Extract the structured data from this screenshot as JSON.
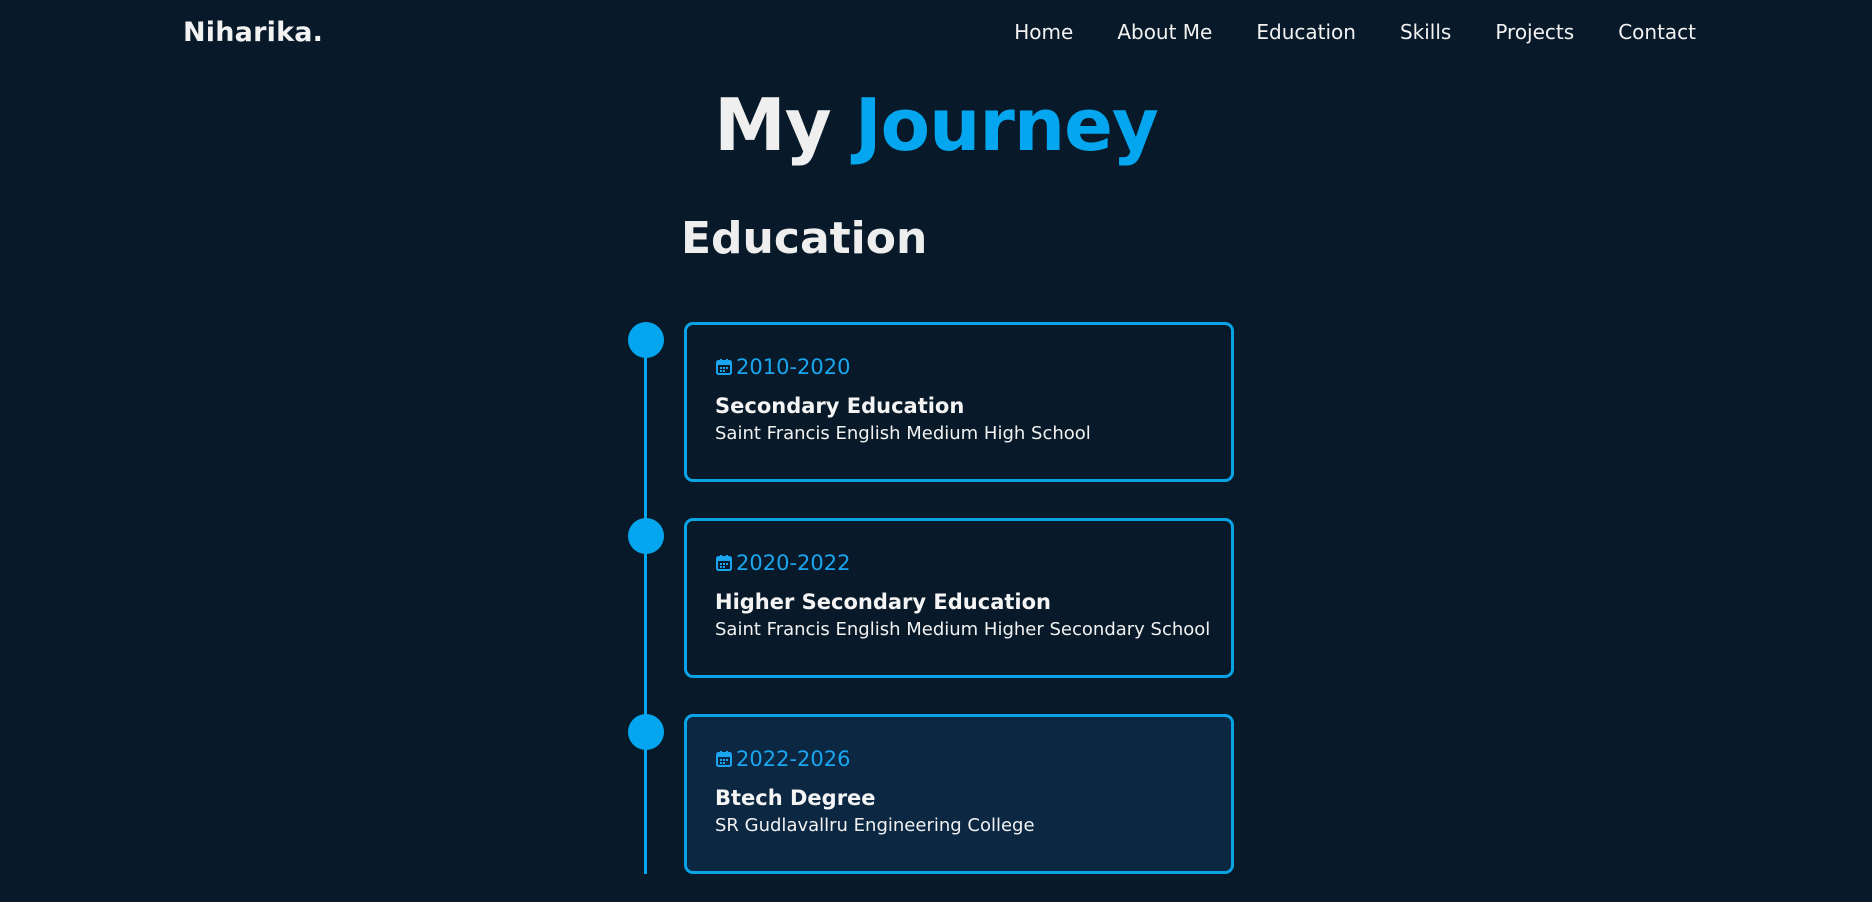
{
  "header": {
    "logo": "Niharika.",
    "nav": [
      {
        "label": "Home"
      },
      {
        "label": "About Me"
      },
      {
        "label": "Education"
      },
      {
        "label": "Skills"
      },
      {
        "label": "Projects"
      },
      {
        "label": "Contact"
      }
    ]
  },
  "page_title": {
    "part1": "My",
    "part2": "Journey"
  },
  "section": {
    "heading": "Education"
  },
  "timeline": [
    {
      "date": "2010-2020",
      "title": "Secondary Education",
      "subtitle": "Saint Francis English Medium High School",
      "icon": "calendar-icon"
    },
    {
      "date": "2020-2022",
      "title": "Higher Secondary Education",
      "subtitle": "Saint Francis English Medium Higher Secondary School",
      "icon": "calendar-icon"
    },
    {
      "date": "2022-2026",
      "title": "Btech Degree",
      "subtitle": "SR Gudlavallru Engineering College",
      "icon": "calendar-icon"
    }
  ],
  "colors": {
    "background": "#081a29",
    "accent": "#04a7ef",
    "active_card": "#0b2742",
    "text": "#f2f2f2"
  }
}
